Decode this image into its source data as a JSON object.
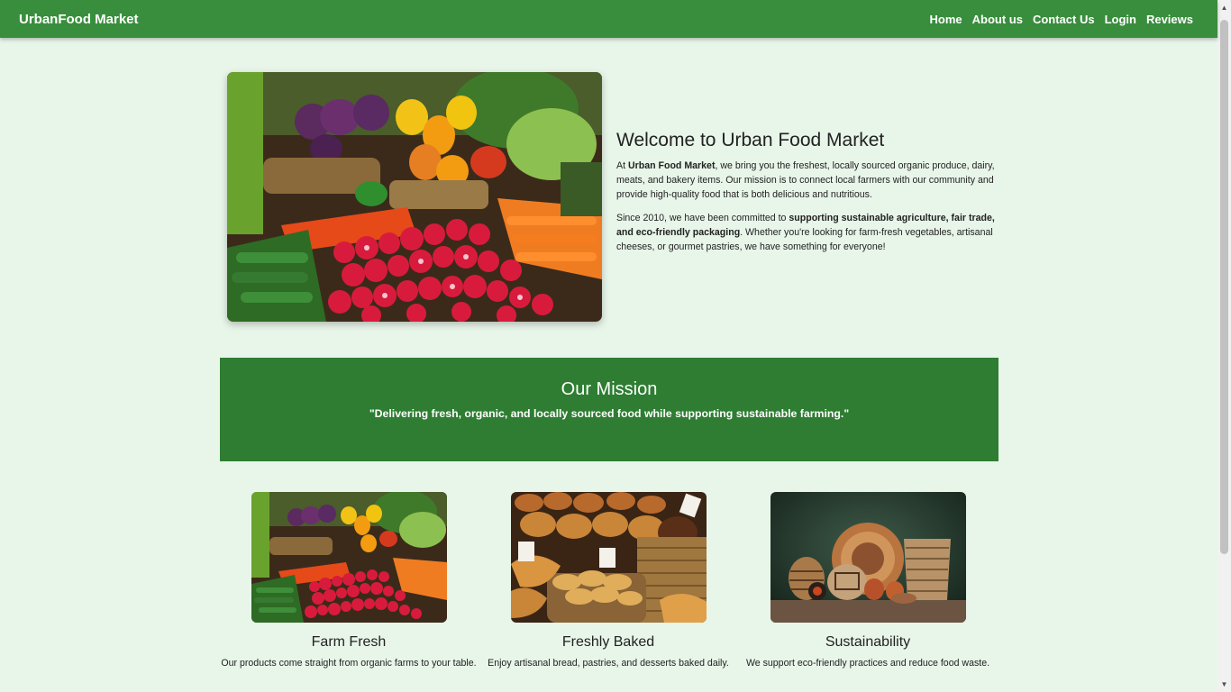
{
  "navbar": {
    "brand": "UrbanFood Market",
    "links": [
      "Home",
      "About us",
      "Contact Us",
      "Login",
      "Reviews"
    ]
  },
  "hero": {
    "title": "Welcome to Urban Food Market",
    "p1": {
      "a": "At ",
      "b": "Urban Food Market",
      "c": ", we bring you the freshest, locally sourced organic produce, dairy, meats, and bakery items. Our mission is to connect local farmers with our community and provide high-quality food that is both delicious and nutritious."
    },
    "p2": {
      "a": "Since 2010, we have been committed to ",
      "b": "supporting sustainable agriculture, fair trade, and eco-friendly packaging",
      "c": ". Whether you're looking for farm-fresh vegetables, artisanal cheeses, or gourmet pastries, we have something for everyone!"
    }
  },
  "mission": {
    "title": "Our Mission",
    "quote": "\"Delivering fresh, organic, and locally sourced food while supporting sustainable farming.\""
  },
  "features": [
    {
      "title": "Farm Fresh",
      "text": "Our products come straight from organic farms to your table."
    },
    {
      "title": "Freshly Baked",
      "text": "Enjoy artisanal bread, pastries, and desserts baked daily."
    },
    {
      "title": "Sustainability",
      "text": "We support eco-friendly practices and reduce food waste."
    }
  ],
  "colors": {
    "navbar": "#388e3c",
    "page_background": "#e8f5e9",
    "mission_background": "#2e7d32"
  },
  "icons": [
    "scroll-up-arrow-icon",
    "scroll-down-arrow-icon"
  ]
}
